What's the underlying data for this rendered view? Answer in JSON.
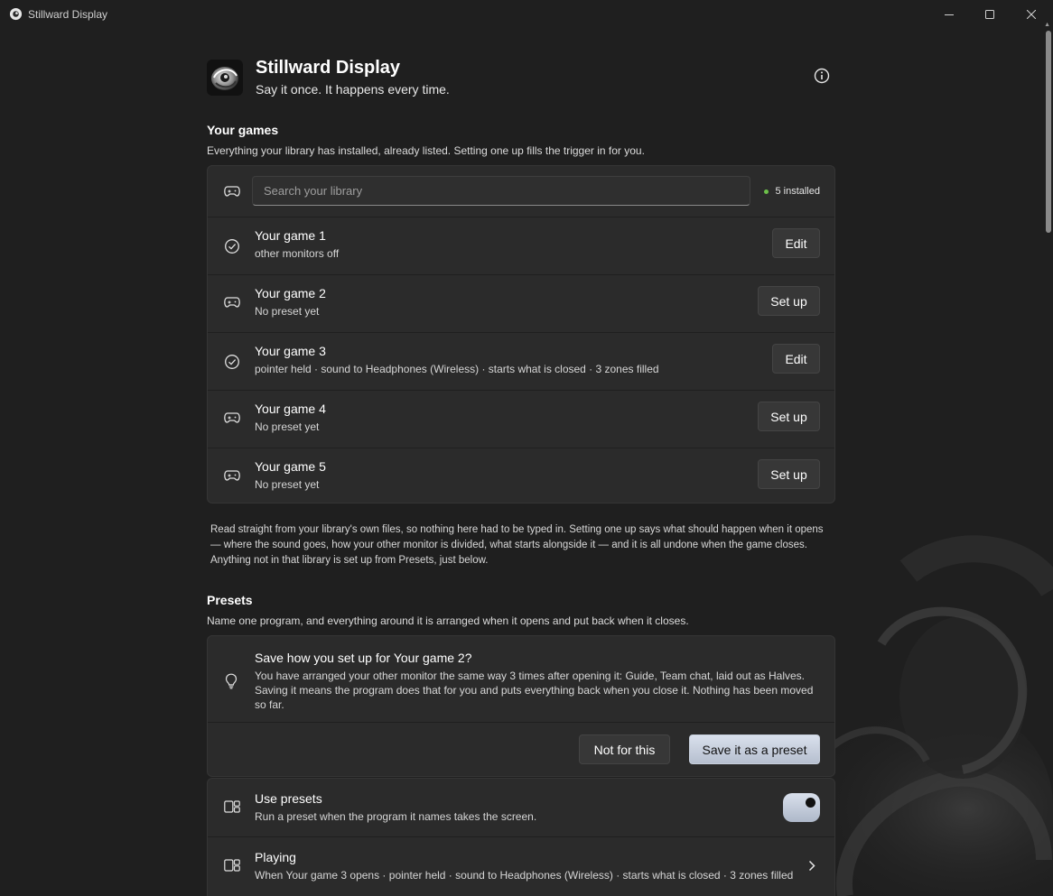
{
  "window": {
    "title": "Stillward Display"
  },
  "header": {
    "app_name": "Stillward Display",
    "tagline": "Say it once. It happens every time.",
    "info_icon": "info-icon"
  },
  "games": {
    "title": "Your games",
    "subtitle": "Everything your library has installed, already listed. Setting one up fills the trigger in for you.",
    "search_placeholder": "Search your library",
    "installed_label": "5 installed",
    "status_color": "#6cc04a",
    "items": [
      {
        "title": "Your game 1",
        "subtitle": "other monitors off",
        "icon": "check-circle-icon",
        "action": "Edit"
      },
      {
        "title": "Your game 2",
        "subtitle": "No preset yet",
        "icon": "gamepad-icon",
        "action": "Set up"
      },
      {
        "title": "Your game 3",
        "subtitle": "pointer held · sound to Headphones (Wireless) · starts what is closed · 3 zones filled",
        "icon": "check-circle-icon",
        "action": "Edit"
      },
      {
        "title": "Your game 4",
        "subtitle": "No preset yet",
        "icon": "gamepad-icon",
        "action": "Set up"
      },
      {
        "title": "Your game 5",
        "subtitle": "No preset yet",
        "icon": "gamepad-icon",
        "action": "Set up"
      }
    ],
    "note": "Read straight from your library's own files, so nothing here had to be typed in. Setting one up says what should happen when it opens — where the sound goes, how your other monitor is divided, what starts alongside it — and it is all undone when the game closes. Anything not in that library is set up from Presets, just below."
  },
  "presets": {
    "title": "Presets",
    "subtitle": "Name one program, and everything around it is arranged when it opens and put back when it closes.",
    "suggestion": {
      "title": "Save how you set up for Your game 2?",
      "body": "You have arranged your other monitor the same way 3 times after opening it: Guide, Team chat, laid out as Halves. Saving it means the program does that for you and puts everything back when you close it. Nothing has been moved so far.",
      "dismiss_label": "Not for this",
      "save_label": "Save it as a preset"
    },
    "use_presets": {
      "title": "Use presets",
      "subtitle": "Run a preset when the program it names takes the screen.",
      "enabled": true
    },
    "playing": {
      "title": "Playing",
      "subtitle": "When Your game 3 opens · pointer held · sound to Headphones (Wireless) · starts what is closed · 3 zones filled"
    }
  }
}
